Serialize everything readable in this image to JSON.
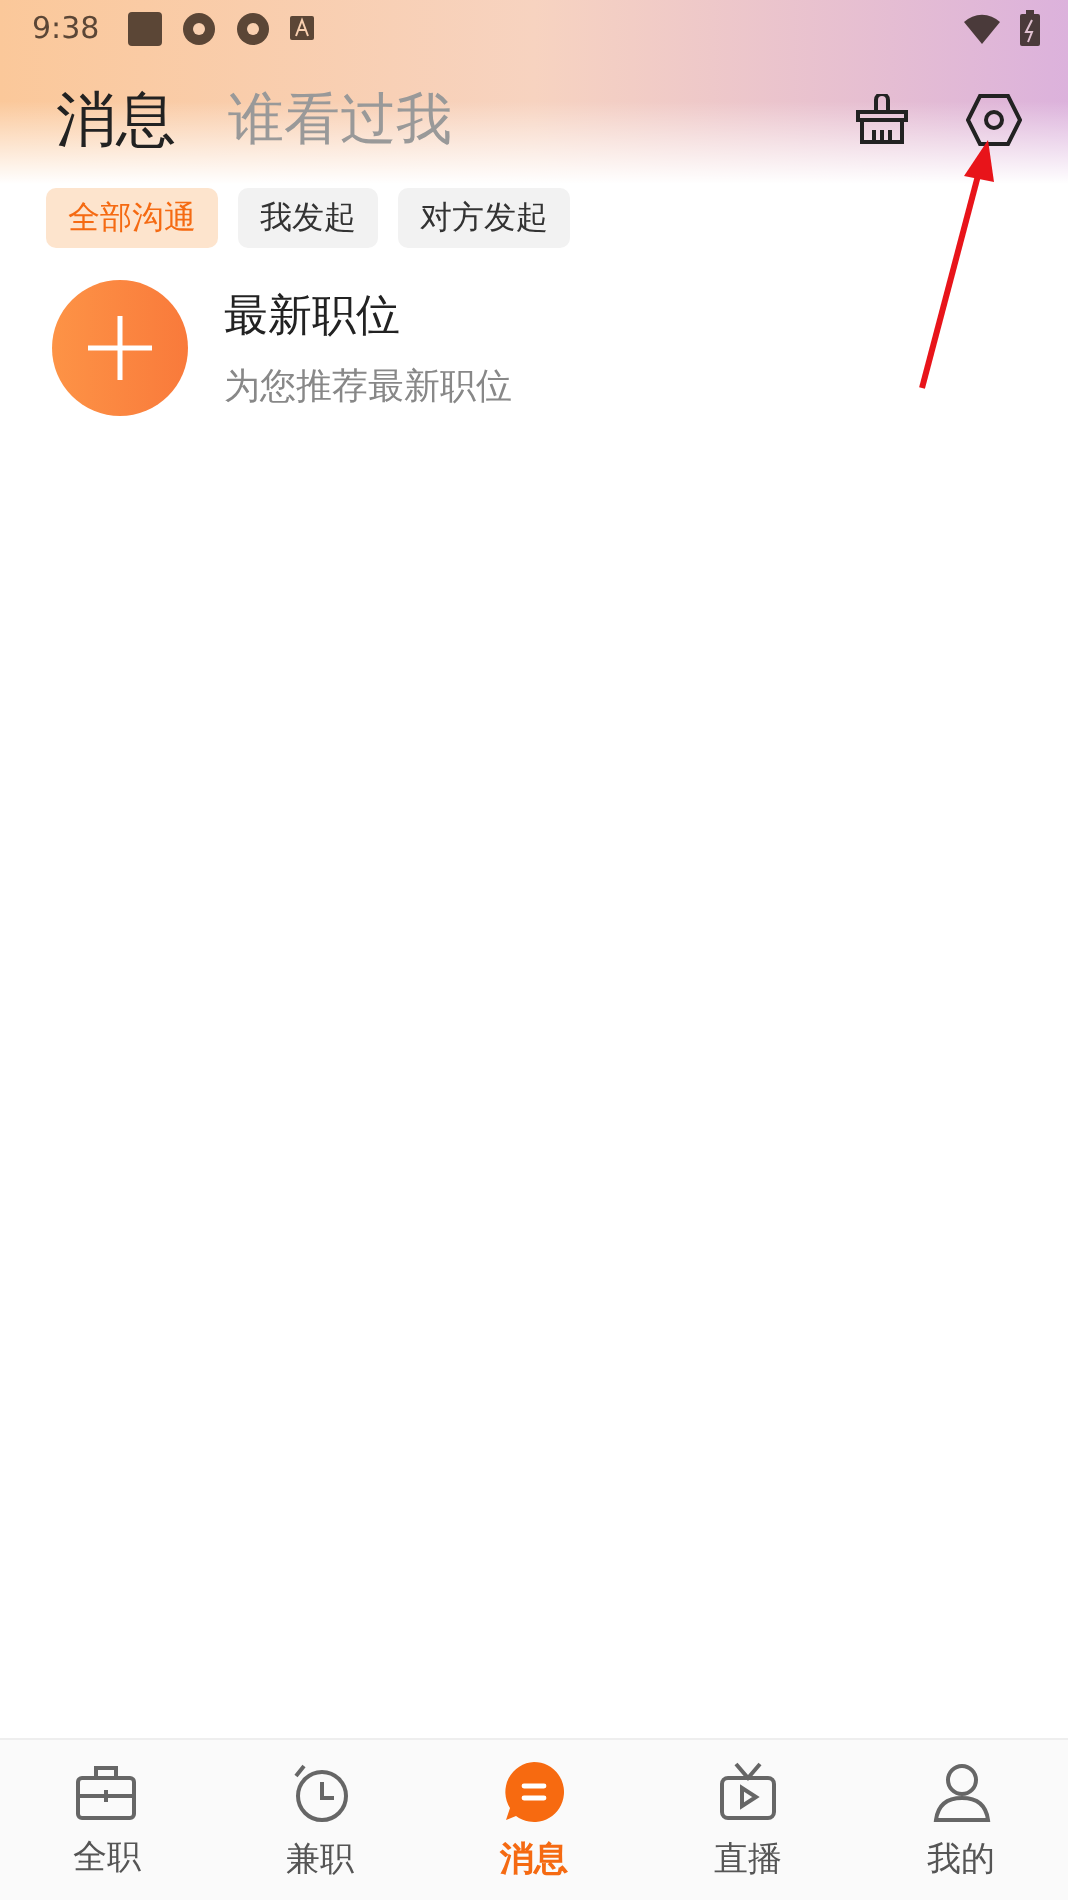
{
  "status_bar": {
    "time": "9:38"
  },
  "header": {
    "tabs": [
      {
        "label": "消息",
        "selected": true
      },
      {
        "label": "谁看过我",
        "selected": false
      }
    ]
  },
  "filters": [
    {
      "label": "全部沟通",
      "selected": true
    },
    {
      "label": "我发起",
      "selected": false
    },
    {
      "label": "对方发起",
      "selected": false
    }
  ],
  "items": [
    {
      "title": "最新职位",
      "subtitle": "为您推荐最新职位"
    }
  ],
  "bottom_nav": [
    {
      "label": "全职",
      "selected": false
    },
    {
      "label": "兼职",
      "selected": false
    },
    {
      "label": "消息",
      "selected": true
    },
    {
      "label": "直播",
      "selected": false
    },
    {
      "label": "我的",
      "selected": false
    }
  ]
}
